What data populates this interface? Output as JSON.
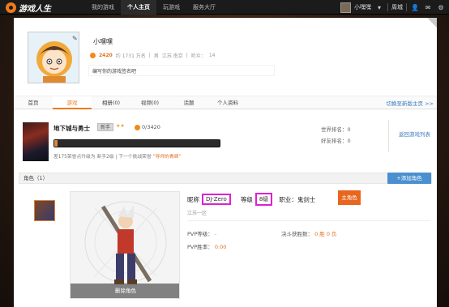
{
  "topbar": {
    "logo_text": "游戏人生",
    "nav": [
      "我的游戏",
      "个人主页",
      "玩游戏",
      "服务大厅"
    ],
    "active_nav": 1,
    "user_name": "小嘿嘿",
    "city": "周城"
  },
  "profile": {
    "username": "小嘿嘿",
    "coins": "2420",
    "rank": "约 1731 万名",
    "gender_label": "男",
    "location": "江苏 南京",
    "listeners_label": "听众：",
    "listeners": "14",
    "signature_placeholder": "编写你的游戏签名吧"
  },
  "tabs": [
    "首页",
    "游戏",
    "相册(0)",
    "视频(0)",
    "话题",
    "个人资料"
  ],
  "active_tab": 1,
  "switch_link": "切换至新版主页 >>",
  "game": {
    "title": "地下城与勇士",
    "rank_badge": "新手",
    "stars": "★★",
    "exp": "0/3420",
    "progress": 0.02,
    "tip_prefix": "差175荣誉点升级为 新手2级 | 下一个挑战荣誉",
    "tip_highlight": "“导师的青睐”",
    "world_rank_label": "世界排名：",
    "world_rank_value": "0",
    "friend_rank_label": "好友排名：",
    "friend_rank_value": "0",
    "back_link": "返回游戏列表"
  },
  "roles": {
    "header": "角色（1）",
    "add_button": "+添加角色",
    "delete_label": "删除角色",
    "nickname_label": "昵称",
    "nickname_value": "DJ-Zero",
    "level_label": "等级",
    "level_value": "8级",
    "class_label": "职业：",
    "class_value": "鬼剑士",
    "main_tag": "主角色",
    "server": "江苏一区",
    "pvp_level_label": "PVP等级：",
    "pvp_level_value": "-",
    "pvp_win_label": "PVP胜率：",
    "pvp_win_value": "0.00",
    "duel_label": "决斗获胜数：",
    "duel_wins": "0",
    "duel_mid": "胜",
    "duel_losses": "0",
    "duel_end": "负"
  },
  "colors": {
    "accent": "#f07a1a",
    "highlight_box": "#e020d0",
    "link": "#3b7bbf"
  }
}
